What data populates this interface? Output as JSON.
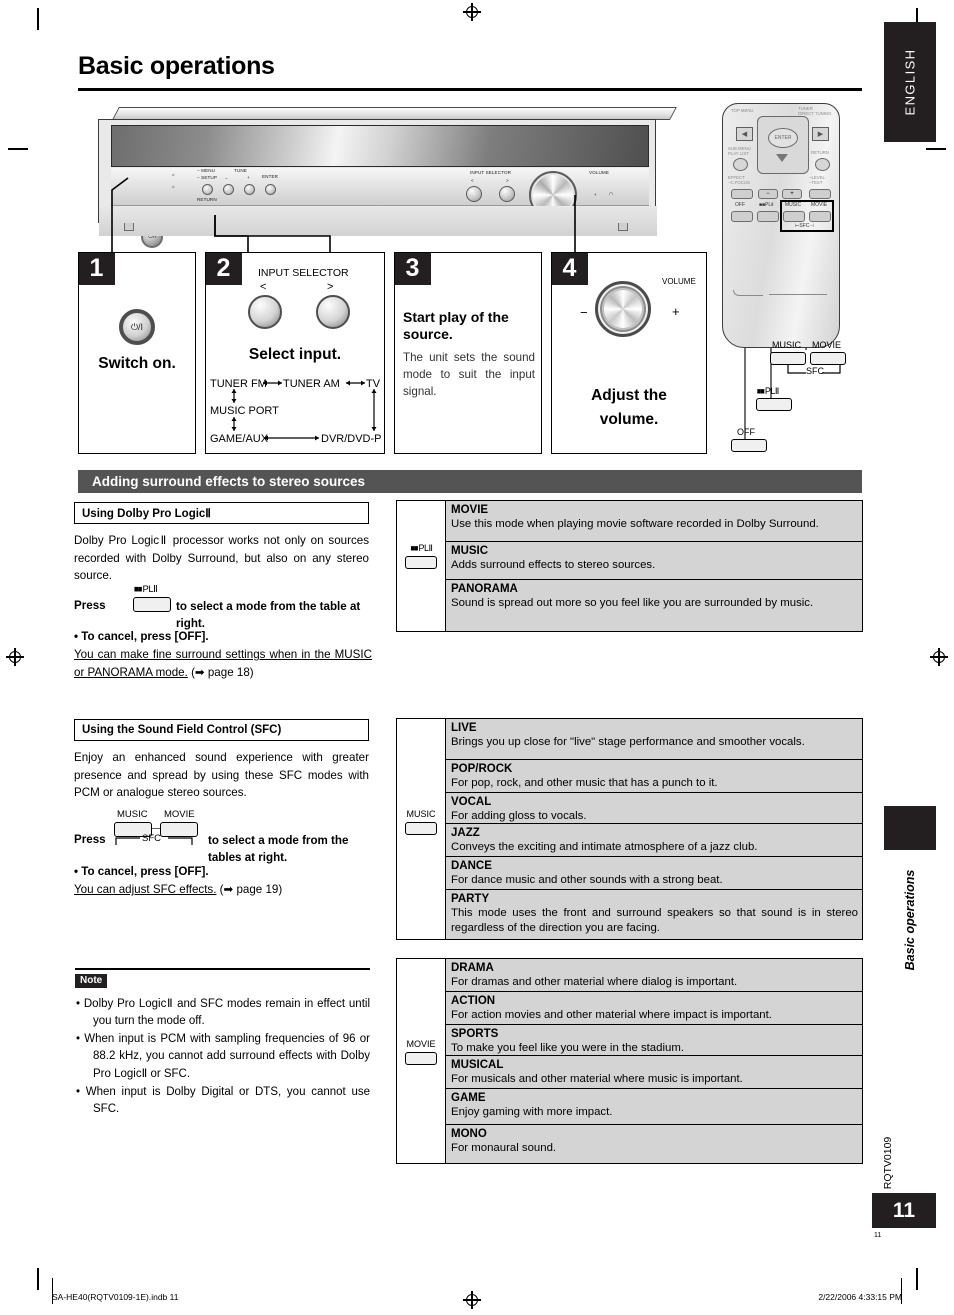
{
  "page": {
    "title": "Basic operations",
    "language_tab": "ENGLISH",
    "chapter_label": "Basic operations",
    "doc_code": "RQTV0109",
    "page_number": "11",
    "page_number_small": "11",
    "footer_left": "SA-HE40(RQTV0109-1E).indb   11",
    "footer_right": "2/22/2006   4:33:15 PM"
  },
  "device": {
    "labels": {
      "menu": "MENU",
      "setup": "SETUP",
      "return": "RETURN",
      "tune": "TUNE",
      "minus": "−",
      "plus": "+",
      "enter": "ENTER",
      "music_port": "MUSIC PORT",
      "input_selector": "INPUT SELECTOR",
      "prev": "<",
      "next": ">",
      "volume": "VOLUME",
      "power": "⏻/I",
      "vol_minus": "−",
      "vol_plus": "+",
      "headphone": "∩"
    }
  },
  "steps": [
    {
      "num": "1",
      "caption": "Switch on.",
      "icon": "power-button"
    },
    {
      "num": "2",
      "caption": "Select input.",
      "header": "INPUT SELECTOR",
      "arrow_left": "<",
      "arrow_right": ">",
      "flow": {
        "row1_a": "TUNER FM",
        "row1_b": "TUNER AM",
        "row1_c": "TV",
        "row2": "MUSIC PORT",
        "row3_a": "GAME/AUX",
        "row3_b": "DVR/DVD-P"
      }
    },
    {
      "num": "3",
      "caption": "Start play of the source.",
      "body": "The unit sets the sound mode to suit the input signal."
    },
    {
      "num": "4",
      "caption_line1": "Adjust the",
      "caption_line2": "volume.",
      "volume_label": "VOLUME",
      "minus": "−",
      "plus": "+"
    }
  ],
  "remote": {
    "labels": {
      "top_menu": "TOP MENU",
      "tuner": "TUNER",
      "direct_tuning": "DIRECT TUNING",
      "enter": "ENTER",
      "sub_menu": "SUB MENU",
      "play_list": "PLAY LIST",
      "return": "RETURN",
      "effect": "EFFECT",
      "c_focus": "C.FOCUS",
      "level": "LEVEL",
      "test": "TEST",
      "minus": "−",
      "plus": "+",
      "off": "OFF",
      "plii": "PLⅡ",
      "music": "MUSIC",
      "movie": "MOVIE",
      "sfc": "SFC"
    },
    "callouts": {
      "music": "MUSIC",
      "movie": "MOVIE",
      "sfc": "SFC",
      "plii": "PLⅡ",
      "off": "OFF"
    }
  },
  "section": {
    "bar_title": "Adding surround effects to stereo sources"
  },
  "dolby": {
    "subhead": "Using Dolby Pro LogicⅡ",
    "paragraph": "Dolby Pro LogicⅡ processor works not only on sources recorded with Dolby Surround, but also on any stereo source.",
    "button_label": "PLⅡ",
    "press_before": "Press",
    "press_after": "to select a mode from the table at right.",
    "cancel": "•  To cancel, press [OFF].",
    "fine_note": "You can make fine surround settings when in the MUSIC or PANORAMA mode.",
    "fine_ref": "(➡ page 18)",
    "table_button": "PLⅡ",
    "modes": [
      {
        "name": "MOVIE",
        "desc": "Use this mode when playing movie software recorded in Dolby Surround."
      },
      {
        "name": "MUSIC",
        "desc": "Adds surround effects to stereo sources."
      },
      {
        "name": "PANORAMA",
        "desc": "Sound is spread out more so you feel like you are surrounded by music."
      }
    ]
  },
  "sfc": {
    "subhead": "Using the Sound Field Control (SFC)",
    "paragraph": "Enjoy an enhanced sound experience with greater presence and spread by using these SFC modes with PCM or analogue stereo sources.",
    "btn_music": "MUSIC",
    "btn_movie": "MOVIE",
    "btn_sfc": "SFC",
    "press_before": "Press",
    "press_after": "to select a mode from the tables at right.",
    "cancel": "•  To cancel, press [OFF].",
    "adjust_note": "You can adjust SFC effects.",
    "adjust_ref": "(➡ page 19)",
    "music_table": {
      "button": "MUSIC",
      "modes": [
        {
          "name": "LIVE",
          "desc": "Brings you up close for \"live\" stage performance and smoother vocals."
        },
        {
          "name": "POP/ROCK",
          "desc": "For pop, rock, and other music that has a punch to it."
        },
        {
          "name": "VOCAL",
          "desc": "For adding gloss to vocals."
        },
        {
          "name": "JAZZ",
          "desc": "Conveys the exciting and intimate atmosphere of a jazz club."
        },
        {
          "name": "DANCE",
          "desc": "For dance music and other sounds with a strong beat."
        },
        {
          "name": "PARTY",
          "desc": "This mode uses the front and surround speakers so that sound is in stereo regardless of the direction you are facing."
        }
      ]
    },
    "movie_table": {
      "button": "MOVIE",
      "modes": [
        {
          "name": "DRAMA",
          "desc": "For dramas and other material where dialog is important."
        },
        {
          "name": "ACTION",
          "desc": "For action movies and other material where impact is important."
        },
        {
          "name": "SPORTS",
          "desc": "To make you feel like you were in the stadium."
        },
        {
          "name": "MUSICAL",
          "desc": "For musicals and other material where music is important."
        },
        {
          "name": "GAME",
          "desc": "Enjoy gaming with more impact."
        },
        {
          "name": "MONO",
          "desc": "For monaural sound."
        }
      ]
    }
  },
  "note": {
    "tag": "Note",
    "items": [
      "•  Dolby Pro LogicⅡ and SFC modes remain in effect until you turn the mode off.",
      "•  When input is PCM with sampling frequencies of 96 or 88.2 kHz, you cannot add surround effects with Dolby Pro LogicⅡ or SFC.",
      "•  When input is Dolby Digital or DTS, you cannot use SFC."
    ]
  },
  "colors": {
    "dark": "#231f20",
    "bar_gray": "#545454",
    "table_gray": "#d4d4d4"
  }
}
